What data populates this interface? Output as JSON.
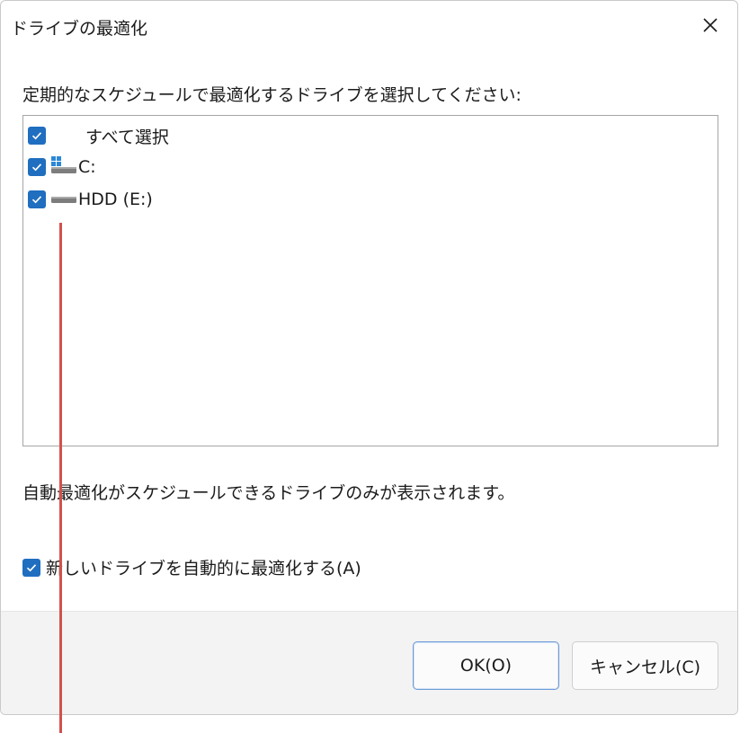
{
  "window": {
    "title": "ドライブの最適化",
    "close_icon": "close-icon"
  },
  "instruction": "定期的なスケジュールで最適化するドライブを選択してください:",
  "drives": [
    {
      "label": "すべて選択",
      "checked": true,
      "icon": "none"
    },
    {
      "label": "C:",
      "checked": true,
      "icon": "windows-drive-icon"
    },
    {
      "label": "HDD (E:)",
      "checked": true,
      "icon": "drive-icon"
    }
  ],
  "hint": "自動最適化がスケジュールできるドライブのみが表示されます。",
  "auto_optimize": {
    "label": "新しいドライブを自動的に最適化する(A)",
    "checked": true
  },
  "buttons": {
    "ok": "OK(O)",
    "cancel": "キャンセル(C)"
  },
  "colors": {
    "checkbox": "#1f6ec0",
    "annotation_line": "#d0524d",
    "footer": "#f3f3f3"
  }
}
